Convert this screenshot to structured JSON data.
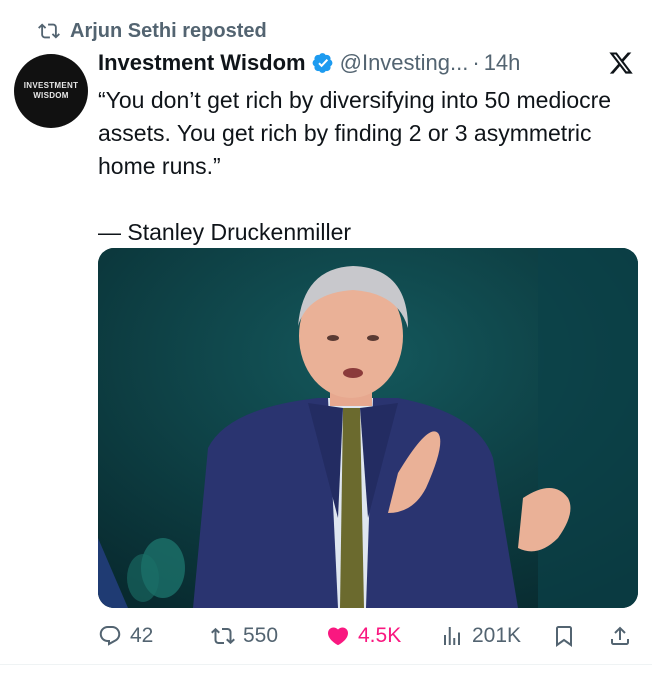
{
  "repost": {
    "text": "Arjun Sethi reposted"
  },
  "avatar": {
    "line1": "INVESTMENT",
    "line2": "WISDOM"
  },
  "author": {
    "name": "Investment Wisdom",
    "handle": "@Investing...",
    "separator": "·",
    "time": "14h"
  },
  "tweet": {
    "quote": "“You don’t get rich by diversifying into 50 mediocre assets. You get rich by finding 2 or 3 asymmetric home runs.”",
    "attribution": "— Stanley Druckenmiller"
  },
  "actions": {
    "replies": "42",
    "reposts": "550",
    "likes": "4.5K",
    "views": "201K"
  },
  "colors": {
    "accent_like": "#f91880",
    "verified": "#1d9bf0",
    "muted": "#536471"
  },
  "icons": [
    "repost-icon",
    "verified-icon",
    "x-logo-icon",
    "reply-icon",
    "retweet-icon",
    "heart-icon",
    "views-icon",
    "bookmark-icon",
    "share-icon"
  ]
}
